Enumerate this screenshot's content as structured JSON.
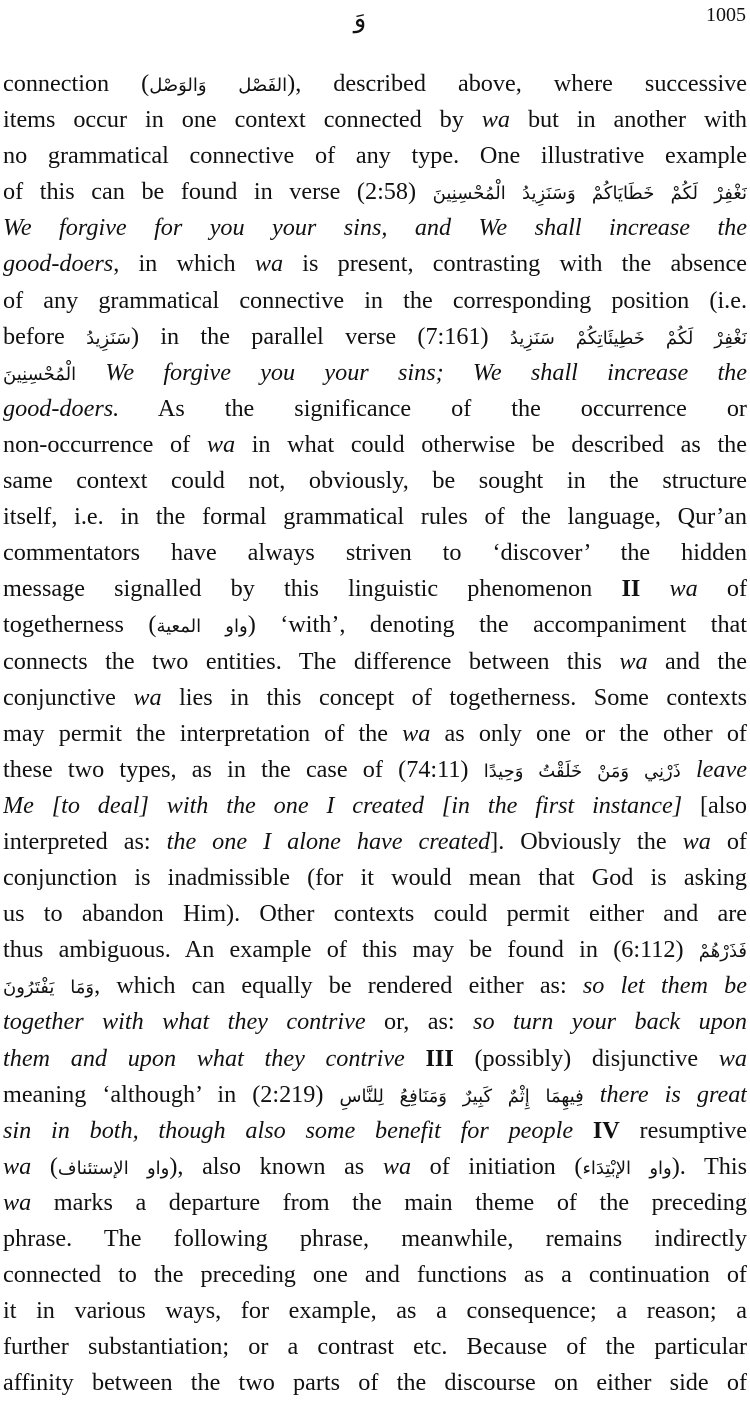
{
  "header": {
    "letter": "وَ",
    "page_number": "1005"
  },
  "lines": [
    [
      {
        "t": "connection ("
      },
      {
        "t": "الفَصْل وَالوَصْل",
        "ar": true
      },
      {
        "t": "), described above, where successive"
      }
    ],
    [
      {
        "t": "items occur in one context connected by "
      },
      {
        "t": "wa",
        "i": true
      },
      {
        "t": " but in another with"
      }
    ],
    [
      {
        "t": "no grammatical connective of any type. One illustrative example"
      }
    ],
    [
      {
        "t": "of this can be found in verse (2:58) "
      },
      {
        "t": "نَغْفِرْ لَكُمْ خَطَايَاكُمْ وَسَنَزِيدُ الْمُحْسِنِينَ",
        "ar": true
      }
    ],
    [
      {
        "t": "We forgive for you your sins, and We shall increase the",
        "i": true
      }
    ],
    [
      {
        "t": "good-doers",
        "i": true
      },
      {
        "t": ", in which "
      },
      {
        "t": "wa",
        "i": true
      },
      {
        "t": " is present, contrasting with the absence"
      }
    ],
    [
      {
        "t": "of any grammatical connective in the corresponding position (i.e."
      }
    ],
    [
      {
        "t": "before "
      },
      {
        "t": "سَنَزِيدُ",
        "ar": true
      },
      {
        "t": ") in the parallel verse (7:161) "
      },
      {
        "t": "نَغْفِرْ لَكُمْ خَطِيئَاتِكُمْ سَنَزِيدُ",
        "ar": true
      }
    ],
    [
      {
        "t": "الْمُحْسِنِينَ",
        "ar": true
      },
      {
        "t": " We forgive you your sins; We shall increase the",
        "i": true
      }
    ],
    [
      {
        "t": "good-doers.",
        "i": true
      },
      {
        "t": " As the significance of the occurrence or"
      }
    ],
    [
      {
        "t": "non-occurrence of "
      },
      {
        "t": "wa",
        "i": true
      },
      {
        "t": " in what could otherwise be described as the"
      }
    ],
    [
      {
        "t": "same context could not, obviously, be sought in the structure"
      }
    ],
    [
      {
        "t": "itself, i.e. in the formal grammatical rules of the language, Qur’an"
      }
    ],
    [
      {
        "t": "commentators have always striven to ‘discover’ the hidden"
      }
    ],
    [
      {
        "t": "message signalled by this linguistic phenomenon "
      },
      {
        "t": "II",
        "b": true
      },
      {
        "t": " "
      },
      {
        "t": "wa",
        "i": true
      },
      {
        "t": " of"
      }
    ],
    [
      {
        "t": "togetherness ("
      },
      {
        "t": "واو المعية",
        "ar": true
      },
      {
        "t": ") ‘with’, denoting the accompaniment that"
      }
    ],
    [
      {
        "t": "connects the two entities. The difference between this "
      },
      {
        "t": "wa",
        "i": true
      },
      {
        "t": " and the"
      }
    ],
    [
      {
        "t": "conjunctive "
      },
      {
        "t": "wa",
        "i": true
      },
      {
        "t": " lies in this concept of togetherness. Some contexts"
      }
    ],
    [
      {
        "t": "may permit the interpretation of the "
      },
      {
        "t": "wa",
        "i": true
      },
      {
        "t": " as only one or the other of"
      }
    ],
    [
      {
        "t": "these two types, as in the case of (74:11) "
      },
      {
        "t": "ذَرْنِي وَمَنْ خَلَقْتُ وَحِيدًا",
        "ar": true
      },
      {
        "t": " leave",
        "i": true
      }
    ],
    [
      {
        "t": "Me [to deal] with the one I created [in the first instance]",
        "i": true
      },
      {
        "t": " [also"
      }
    ],
    [
      {
        "t": "interpreted as: "
      },
      {
        "t": "the one I alone have created",
        "i": true
      },
      {
        "t": "]. Obviously the "
      },
      {
        "t": "wa",
        "i": true
      },
      {
        "t": " of"
      }
    ],
    [
      {
        "t": "conjunction is inadmissible (for it would mean that God is asking"
      }
    ],
    [
      {
        "t": "us to abandon Him). Other contexts could permit either and are"
      }
    ],
    [
      {
        "t": "thus ambiguous. An example of this may be found in (6:112) "
      },
      {
        "t": "فَذَرْهُمْ",
        "ar": true
      }
    ],
    [
      {
        "t": "وَمَا يَفْتَرُونَ",
        "ar": true
      },
      {
        "t": ", which can equally be rendered either as: "
      },
      {
        "t": "so let them be",
        "i": true
      }
    ],
    [
      {
        "t": "together with what they contrive",
        "i": true
      },
      {
        "t": " or, as: "
      },
      {
        "t": "so turn your back upon",
        "i": true
      }
    ],
    [
      {
        "t": "them and upon what they contrive",
        "i": true
      },
      {
        "t": " "
      },
      {
        "t": "III",
        "b": true
      },
      {
        "t": " (possibly) disjunctive "
      },
      {
        "t": "wa",
        "i": true
      }
    ],
    [
      {
        "t": "meaning ‘although’ in (2:219) "
      },
      {
        "t": "فِيهِمَا إِثْمٌ كَبِيرٌ وَمَنَافِعُ لِلنَّاسِ",
        "ar": true
      },
      {
        "t": " there is great",
        "i": true
      }
    ],
    [
      {
        "t": "sin in both, though also some benefit for people",
        "i": true
      },
      {
        "t": " "
      },
      {
        "t": "IV",
        "b": true
      },
      {
        "t": " resumptive"
      }
    ],
    [
      {
        "t": "wa",
        "i": true
      },
      {
        "t": " ("
      },
      {
        "t": "واو الإستئناف",
        "ar": true
      },
      {
        "t": "), also known as "
      },
      {
        "t": "wa",
        "i": true
      },
      {
        "t": " of initiation ("
      },
      {
        "t": "واو الإبْتِدَاء",
        "ar": true
      },
      {
        "t": "). This"
      }
    ],
    [
      {
        "t": "wa",
        "i": true
      },
      {
        "t": " marks a departure from the main theme of the preceding"
      }
    ],
    [
      {
        "t": "phrase. The following phrase, meanwhile, remains indirectly"
      }
    ],
    [
      {
        "t": "connected to the preceding one and functions as a continuation of"
      }
    ],
    [
      {
        "t": "it in various ways, for example, as a consequence; a reason; a"
      }
    ],
    [
      {
        "t": "further substantiation; or a contrast etc. Because of the particular"
      }
    ],
    [
      {
        "t": "affinity between the two parts of the discourse on either side of"
      }
    ]
  ]
}
